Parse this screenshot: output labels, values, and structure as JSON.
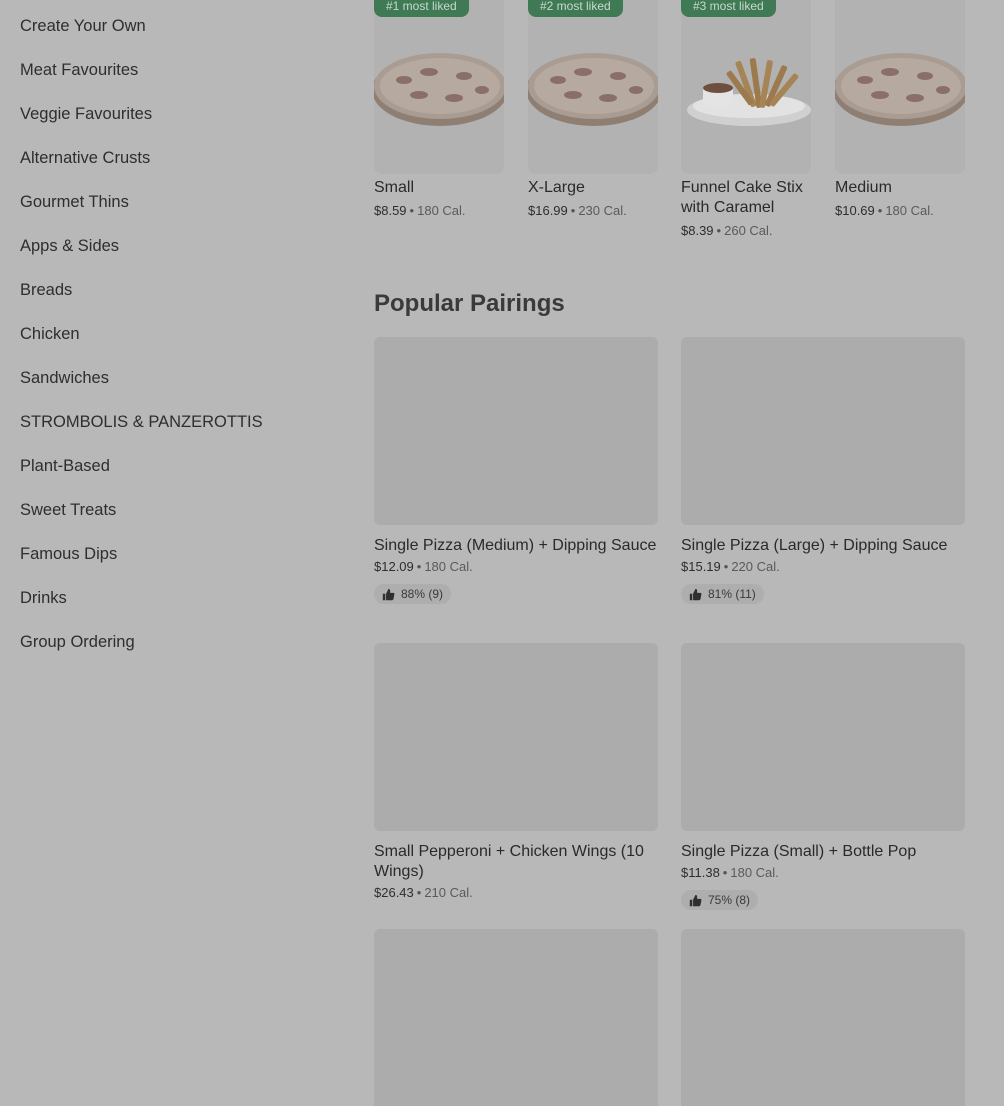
{
  "sidebar": {
    "items": [
      {
        "label": "Create Your Own"
      },
      {
        "label": "Meat Favourites"
      },
      {
        "label": "Veggie Favourites"
      },
      {
        "label": "Alternative Crusts"
      },
      {
        "label": "Gourmet Thins"
      },
      {
        "label": "Apps & Sides"
      },
      {
        "label": "Breads"
      },
      {
        "label": "Chicken"
      },
      {
        "label": "Sandwiches"
      },
      {
        "label": "STROMBOLIS & PANZEROTTIS"
      },
      {
        "label": "Plant-Based"
      },
      {
        "label": "Sweet Treats"
      },
      {
        "label": "Famous Dips"
      },
      {
        "label": "Drinks"
      },
      {
        "label": "Group Ordering"
      }
    ]
  },
  "most_liked": [
    {
      "badge": "#1 most liked",
      "title": "Small",
      "price": "$8.59",
      "sep": "•",
      "cal": "180 Cal.",
      "image_icon": "pizza-icon"
    },
    {
      "badge": "#2 most liked",
      "title": "X-Large",
      "price": "$16.99",
      "sep": "•",
      "cal": "230 Cal.",
      "image_icon": "pizza-icon"
    },
    {
      "badge": "#3 most liked",
      "title": "Funnel Cake Stix with Caramel",
      "price": "$8.39",
      "sep": "•",
      "cal": "260 Cal.",
      "image_icon": "fries-icon"
    },
    {
      "badge": "",
      "title": "Medium",
      "price": "$10.69",
      "sep": "•",
      "cal": "180 Cal.",
      "image_icon": "pizza-icon"
    }
  ],
  "popular_pairings": {
    "title": "Popular Pairings",
    "items": [
      {
        "title": "Single Pizza (Medium) + Dipping Sauce",
        "price": "$12.09",
        "sep": "•",
        "cal": "180 Cal.",
        "likes": "88% (9)"
      },
      {
        "title": "Single Pizza (Large) + Dipping Sauce",
        "price": "$15.19",
        "sep": "•",
        "cal": "220 Cal.",
        "likes": "81% (11)"
      },
      {
        "title": "Small Pepperoni + Chicken Wings (10 Wings)",
        "price": "$26.43",
        "sep": "•",
        "cal": "210 Cal.",
        "likes": ""
      },
      {
        "title": "Single Pizza (Small) + Bottle Pop",
        "price": "$11.38",
        "sep": "•",
        "cal": "180 Cal.",
        "likes": "75% (8)"
      },
      {
        "title": "",
        "price": "",
        "sep": "",
        "cal": "",
        "likes": ""
      },
      {
        "title": "",
        "price": "",
        "sep": "",
        "cal": "",
        "likes": ""
      }
    ]
  },
  "colors": {
    "overlay_bg": "#b8b8b8",
    "badge_green": "#3f7a55",
    "text": "#2f2f2f"
  }
}
